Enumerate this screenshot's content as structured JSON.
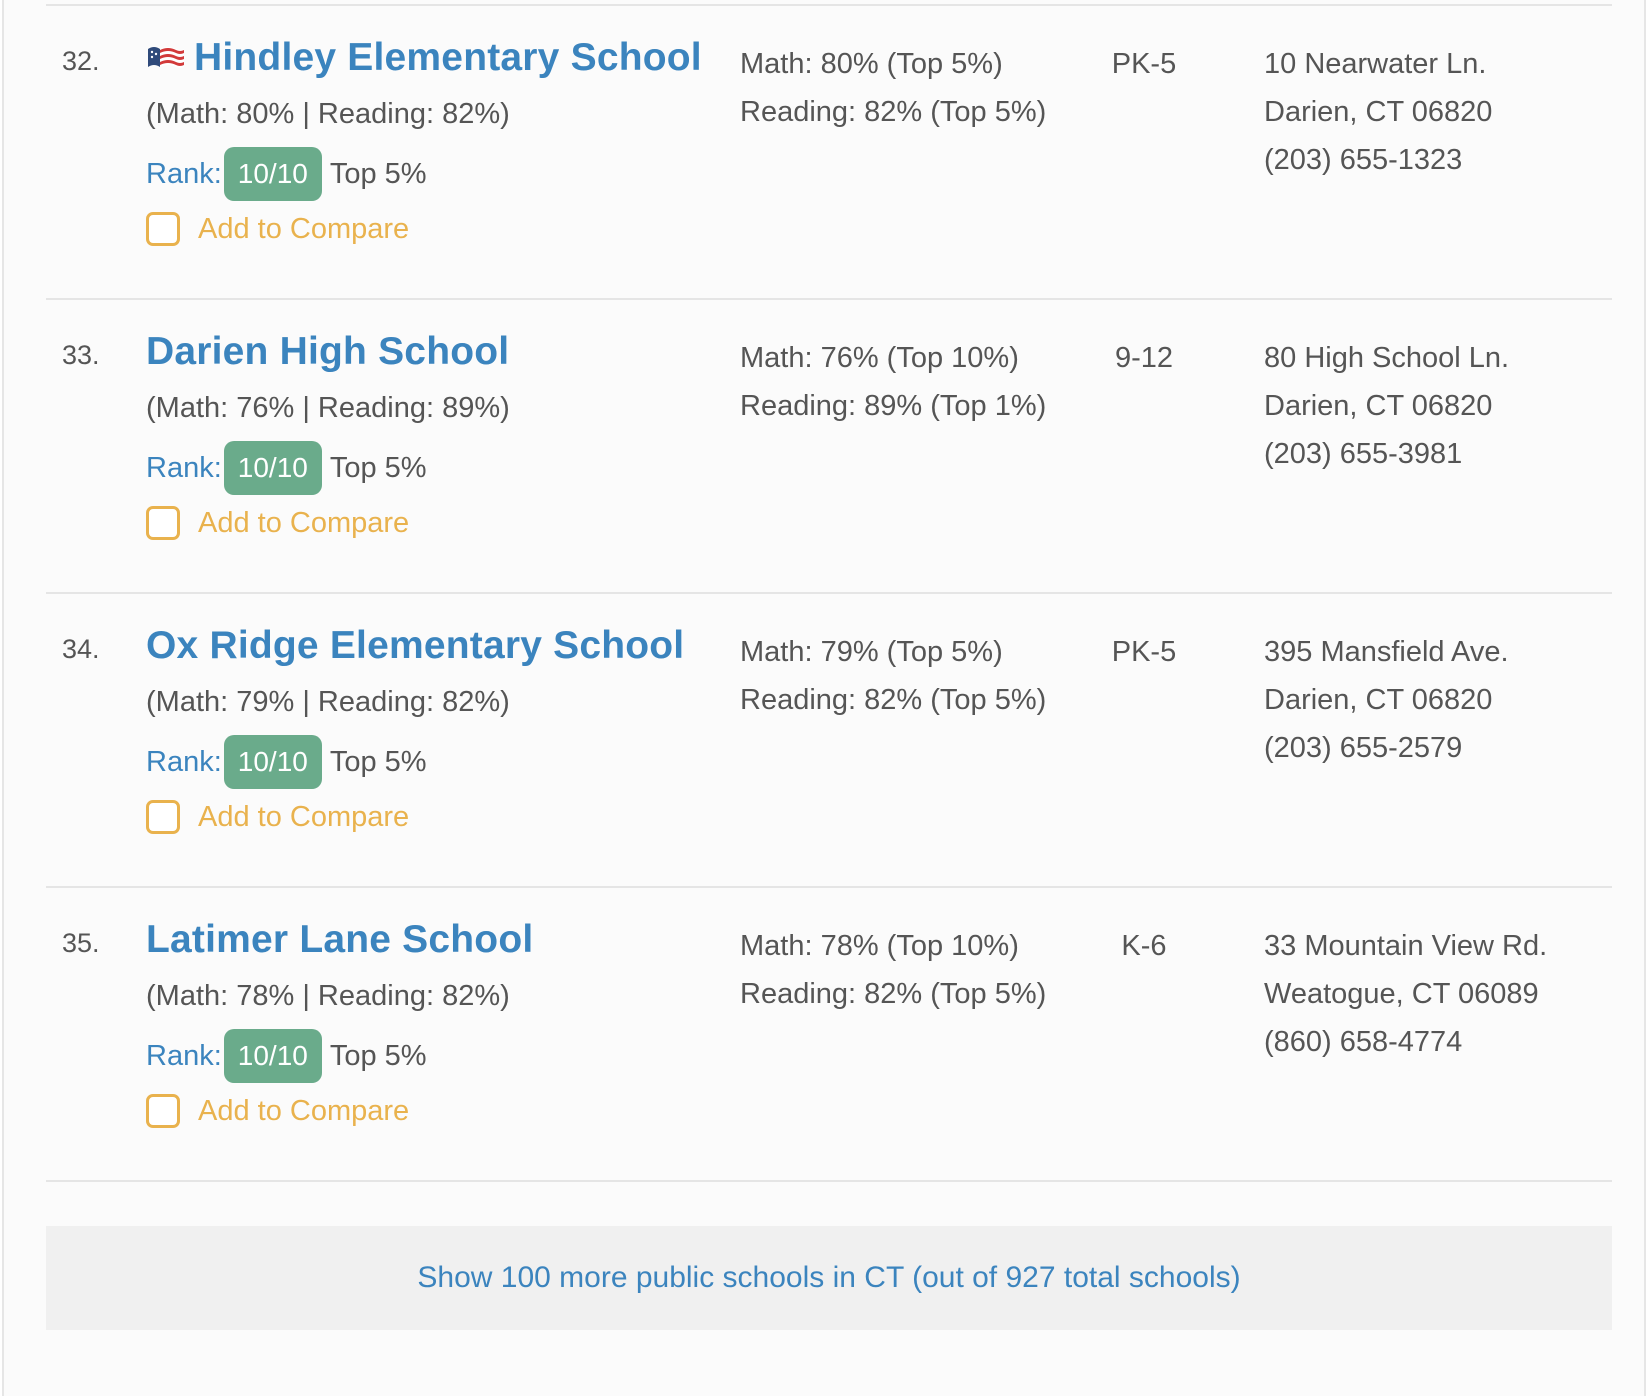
{
  "schools": [
    {
      "rank": "32.",
      "has_icon": true,
      "name": "Hindley Elementary School",
      "scores": "(Math: 80% | Reading: 82%)",
      "rank_label": "Rank:",
      "rank_value": "10/10",
      "rank_top": "Top 5%",
      "compare_label": "Add to Compare",
      "math_perf": "Math: 80% (Top 5%)",
      "reading_perf": "Reading: 82% (Top 5%)",
      "grades": "PK-5",
      "address_line1": "10 Nearwater Ln.",
      "address_line2": "Darien, CT 06820",
      "phone": "(203) 655-1323"
    },
    {
      "rank": "33.",
      "has_icon": false,
      "name": "Darien High School",
      "scores": "(Math: 76% | Reading: 89%)",
      "rank_label": "Rank:",
      "rank_value": "10/10",
      "rank_top": "Top 5%",
      "compare_label": "Add to Compare",
      "math_perf": "Math: 76% (Top 10%)",
      "reading_perf": "Reading: 89% (Top 1%)",
      "grades": "9-12",
      "address_line1": "80 High School Ln.",
      "address_line2": "Darien, CT 06820",
      "phone": "(203) 655-3981"
    },
    {
      "rank": "34.",
      "has_icon": false,
      "name": "Ox Ridge Elementary School",
      "scores": "(Math: 79% | Reading: 82%)",
      "rank_label": "Rank:",
      "rank_value": "10/10",
      "rank_top": "Top 5%",
      "compare_label": "Add to Compare",
      "math_perf": "Math: 79% (Top 5%)",
      "reading_perf": "Reading: 82% (Top 5%)",
      "grades": "PK-5",
      "address_line1": "395 Mansfield Ave.",
      "address_line2": "Darien, CT 06820",
      "phone": "(203) 655-2579"
    },
    {
      "rank": "35.",
      "has_icon": false,
      "name": "Latimer Lane School",
      "scores": "(Math: 78% | Reading: 82%)",
      "rank_label": "Rank:",
      "rank_value": "10/10",
      "rank_top": "Top 5%",
      "compare_label": "Add to Compare",
      "math_perf": "Math: 78% (Top 10%)",
      "reading_perf": "Reading: 82% (Top 5%)",
      "grades": "K-6",
      "address_line1": "33 Mountain View Rd.",
      "address_line2": "Weatogue, CT 06089",
      "phone": "(860) 658-4774"
    }
  ],
  "show_more_label": "Show 100 more public schools in CT (out of 927 total schools)",
  "colors": {
    "link": "#3b84be",
    "rank_badge": "#6aab8b",
    "compare": "#e9b24d",
    "text": "#555555"
  },
  "icons": {
    "school_icon": "flag-icon"
  }
}
